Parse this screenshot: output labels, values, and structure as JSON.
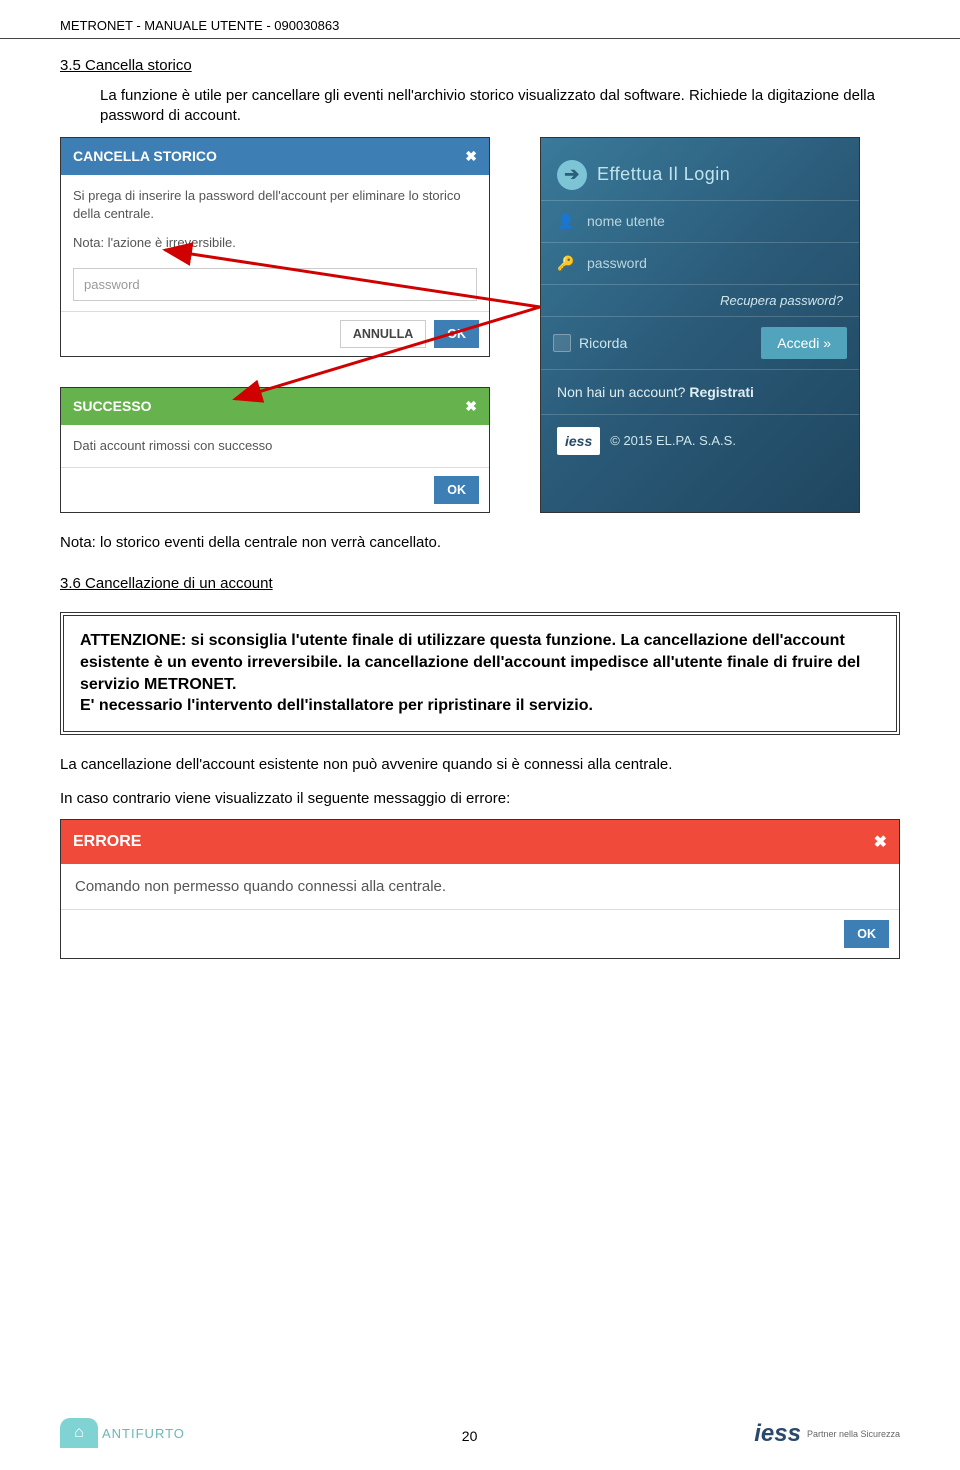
{
  "header": "METRONET  -  MANUALE UTENTE  -  090030863",
  "section1": {
    "title": "3.5 Cancella storico",
    "p1": "La funzione è utile per cancellare gli eventi nell'archivio storico visualizzato dal software. Richiede la digitazione della password di account."
  },
  "cancella_modal": {
    "title": "CANCELLA STORICO",
    "close": "✖",
    "body": "Si prega di inserire la password dell'account per eliminare lo storico della centrale.",
    "note": "Nota: l'azione è irreversibile.",
    "placeholder": "password",
    "btn_cancel": "ANNULLA",
    "btn_ok": "OK"
  },
  "successo_modal": {
    "title": "SUCCESSO",
    "close": "✖",
    "body": "Dati account rimossi con successo",
    "btn_ok": "OK"
  },
  "login": {
    "title": "Effettua Il Login",
    "arrow_icon": "➔",
    "user_icon": "👤",
    "username": "nome utente",
    "pass_icon": "🔑",
    "password": "password",
    "recupera": "Recupera password?",
    "ricorda": "Ricorda",
    "accedi": "Accedi »",
    "register": "Non hai un account?",
    "register_link": "Registrati",
    "iess": "iess",
    "copyright": "© 2015 EL.PA. S.A.S."
  },
  "after_images_note": "Nota: lo storico eventi della centrale non verrà cancellato.",
  "section2": {
    "title": "3.6 Cancellazione di un account"
  },
  "attention": {
    "l1": "ATTENZIONE: si sconsiglia l'utente finale di utilizzare questa funzione. La cancellazione dell'account esistente è un evento irreversibile. la cancellazione dell'account impedisce all'utente finale di fruire del servizio METRONET.",
    "l2": "E' necessario l'intervento dell'installatore per ripristinare il servizio."
  },
  "p_after_attention": "La cancellazione dell'account esistente non può avvenire quando si è connessi alla centrale.",
  "p_error_intro": "In caso contrario viene visualizzato il seguente messaggio di errore:",
  "error_modal": {
    "title": "ERRORE",
    "close": "✖",
    "body": "Comando non permesso quando connessi alla centrale.",
    "btn_ok": "OK"
  },
  "footer": {
    "antifurto_icon": "⌂",
    "antifurto": "ANTIFURTO",
    "pagenum": "20",
    "iess": "iess",
    "iess_sub": "Partner nella Sicurezza"
  }
}
